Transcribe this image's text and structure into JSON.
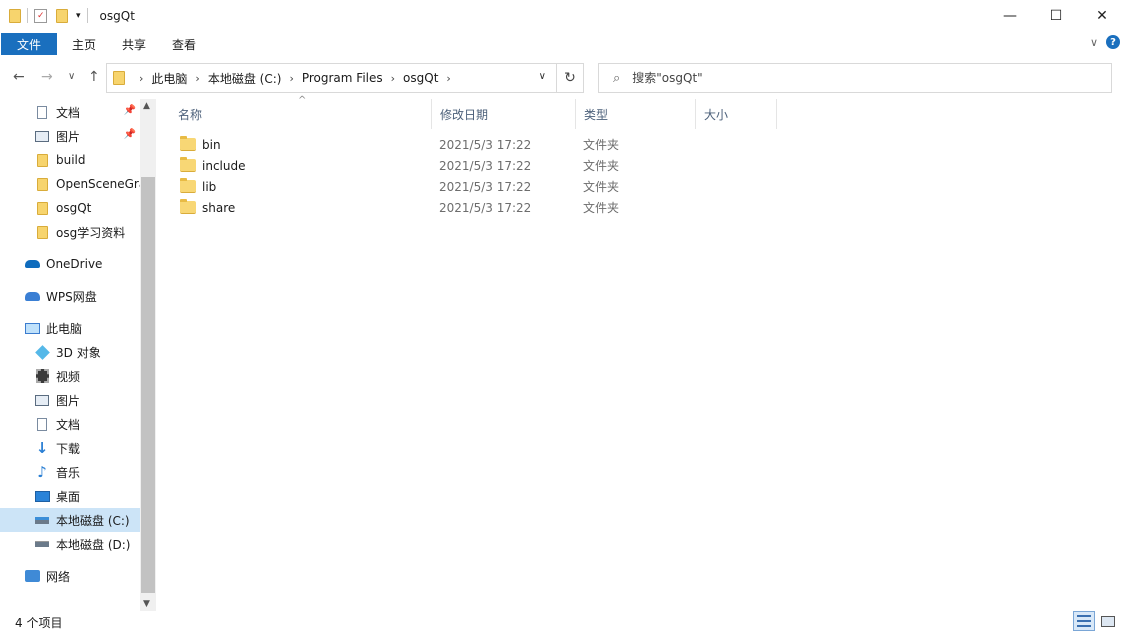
{
  "window": {
    "title": "osgQt",
    "minimize": "—",
    "maximize": "☐",
    "close": "✕"
  },
  "ribbon": {
    "tabs": [
      "文件",
      "主页",
      "共享",
      "查看"
    ],
    "collapse": "∨",
    "help": "?"
  },
  "address": {
    "crumbs": [
      "此电脑",
      "本地磁盘 (C:)",
      "Program Files",
      "osgQt"
    ],
    "back": "←",
    "forward": "→",
    "recent": "∨",
    "up": "↑",
    "dropdown": "∨",
    "refresh": "↻"
  },
  "search": {
    "placeholder": "搜索\"osgQt\""
  },
  "sidebar": {
    "items": [
      {
        "label": "文档",
        "icon": "document-icon",
        "pinned": true
      },
      {
        "label": "图片",
        "icon": "pictures-icon",
        "pinned": true
      },
      {
        "label": "build",
        "icon": "folder-icon"
      },
      {
        "label": "OpenSceneGraph",
        "icon": "folder-icon"
      },
      {
        "label": "osgQt",
        "icon": "folder-icon"
      },
      {
        "label": "osg学习资料",
        "icon": "folder-icon"
      },
      {
        "label": "OneDrive",
        "icon": "onedrive-icon"
      },
      {
        "label": "WPS网盘",
        "icon": "wps-cloud-icon"
      },
      {
        "label": "此电脑",
        "icon": "computer-icon"
      },
      {
        "label": "3D 对象",
        "icon": "3d-objects-icon"
      },
      {
        "label": "视频",
        "icon": "videos-icon"
      },
      {
        "label": "图片",
        "icon": "pictures-icon"
      },
      {
        "label": "文档",
        "icon": "document-icon"
      },
      {
        "label": "下载",
        "icon": "download-icon"
      },
      {
        "label": "音乐",
        "icon": "music-icon"
      },
      {
        "label": "桌面",
        "icon": "desktop-icon"
      },
      {
        "label": "本地磁盘 (C:)",
        "icon": "drive-c-icon",
        "selected": true
      },
      {
        "label": "本地磁盘 (D:)",
        "icon": "drive-d-icon"
      },
      {
        "label": "网络",
        "icon": "network-icon"
      }
    ]
  },
  "columns": {
    "name": "名称",
    "date": "修改日期",
    "type": "类型",
    "size": "大小"
  },
  "files": [
    {
      "name": "bin",
      "date": "2021/5/3 17:22",
      "type": "文件夹"
    },
    {
      "name": "include",
      "date": "2021/5/3 17:22",
      "type": "文件夹"
    },
    {
      "name": "lib",
      "date": "2021/5/3 17:22",
      "type": "文件夹"
    },
    {
      "name": "share",
      "date": "2021/5/3 17:22",
      "type": "文件夹"
    }
  ],
  "status": {
    "count": "4 个项目"
  },
  "colors": {
    "accent": "#1a6fbe",
    "selected": "#cce4f7",
    "folder": "#f8d775"
  }
}
